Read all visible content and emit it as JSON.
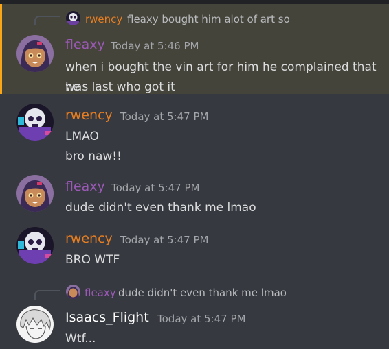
{
  "colors": {
    "background": "#36393f",
    "highlight": "#45443b",
    "highlight_border": "#faa61a",
    "fleaxy": "#9b59b6",
    "rwency": "#e67e22",
    "isaacs": "#ffffff"
  },
  "messages": [
    {
      "reply": {
        "author": "rwency",
        "text": "fleaxy bought him alot of art so"
      },
      "author": "fleaxy",
      "time": "Today at 5:46 PM",
      "lines": [
        "when i bought the vin art for him he complained that he",
        "was last who got it"
      ]
    },
    {
      "author": "rwency",
      "time": "Today at 5:47 PM",
      "lines": [
        "LMAO",
        "bro naw!!"
      ]
    },
    {
      "author": "fleaxy",
      "time": "Today at 5:47 PM",
      "lines": [
        "dude didn't even thank me lmao"
      ]
    },
    {
      "author": "rwency",
      "time": "Today at 5:47 PM",
      "lines": [
        "BRO WTF"
      ]
    },
    {
      "reply": {
        "author": "fleaxy",
        "text": "dude didn't even thank me lmao"
      },
      "author": "Isaacs_Flight",
      "time": "Today at 5:47 PM",
      "lines": [
        "Wtf..."
      ]
    }
  ]
}
